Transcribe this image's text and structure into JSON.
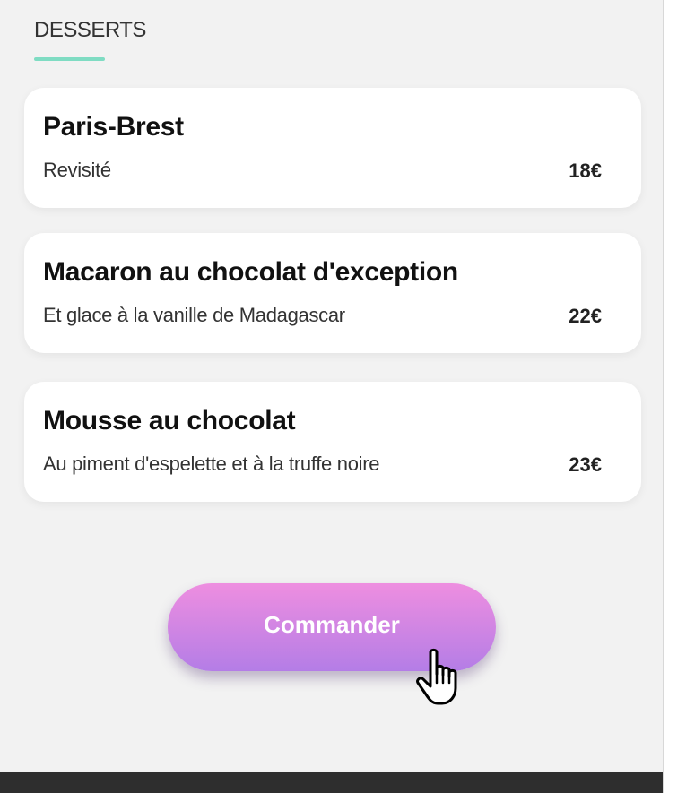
{
  "section": {
    "title": "DESSERTS"
  },
  "menu_items": [
    {
      "name": "Paris-Brest",
      "description": "Revisité",
      "price": "18€"
    },
    {
      "name": "Macaron au chocolat d'exception",
      "description": "Et glace à la vanille de Madagascar",
      "price": "22€"
    },
    {
      "name": "Mousse au chocolat",
      "description": "Au piment d'espelette et à la truffe noire",
      "price": "23€"
    }
  ],
  "order_button": {
    "label": "Commander"
  },
  "cursor": {
    "icon": "hand-pointer-icon"
  },
  "colors": {
    "accent": "#7fdcc3",
    "button_top": "#ee8ee0",
    "button_bottom": "#b47de6",
    "background": "#f2f2f2",
    "footer": "#2e2e2e"
  }
}
